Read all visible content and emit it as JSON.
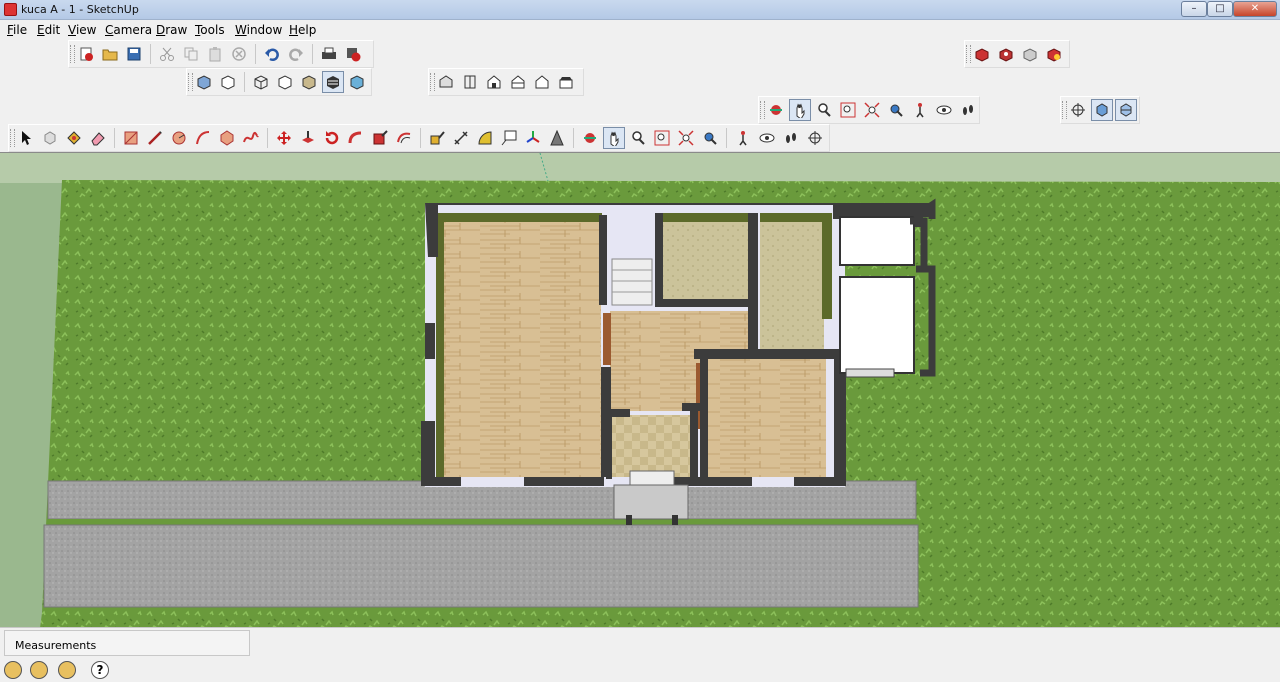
{
  "window": {
    "title": "kuca A - 1 - SketchUp",
    "min_glyph": "–",
    "max_glyph": "□",
    "close_glyph": "✕"
  },
  "menu": [
    {
      "label": "File"
    },
    {
      "label": "Edit"
    },
    {
      "label": "View"
    },
    {
      "label": "Camera"
    },
    {
      "label": "Draw"
    },
    {
      "label": "Tools"
    },
    {
      "label": "Window"
    },
    {
      "label": "Help"
    }
  ],
  "status": {
    "measurements_label": "Measurements",
    "help_glyph": "?"
  },
  "colors": {
    "grass": "#6a9a3c",
    "floor_wood": "#d9c29a",
    "tile": "#cfc197",
    "wall": "#3a3a3a",
    "road": "#a5a5a5"
  }
}
